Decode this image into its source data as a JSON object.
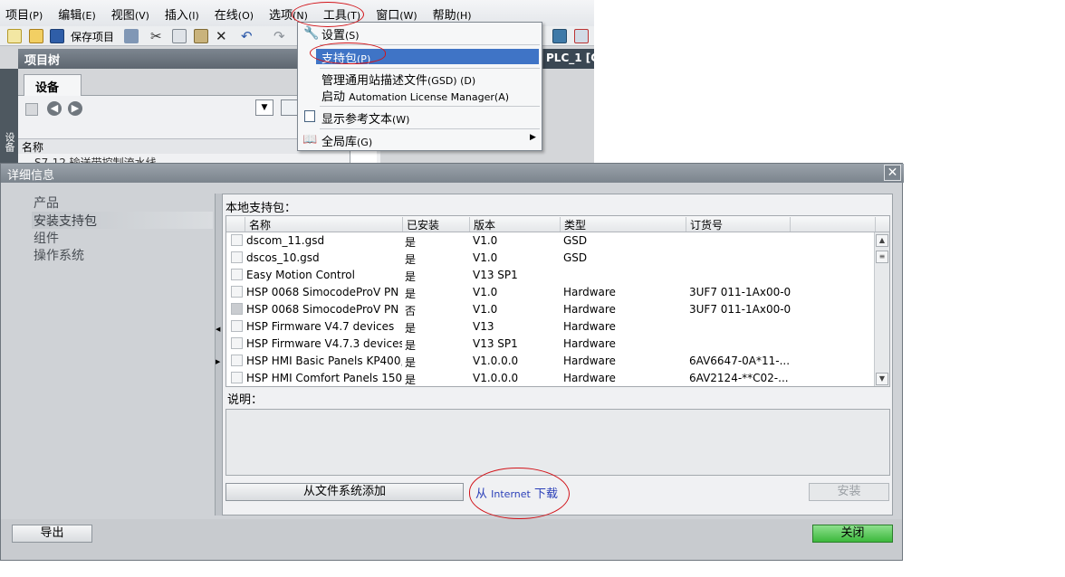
{
  "menubar": {
    "items": [
      {
        "label": "项目",
        "key": "(P)"
      },
      {
        "label": "编辑",
        "key": "(E)"
      },
      {
        "label": "视图",
        "key": "(V)"
      },
      {
        "label": "插入",
        "key": "(I)"
      },
      {
        "label": "在线",
        "key": "(O)"
      },
      {
        "label": "选项",
        "key": "(N)"
      },
      {
        "label": "工具",
        "key": "(T)"
      },
      {
        "label": "窗口",
        "key": "(W)"
      },
      {
        "label": "帮助",
        "key": "(H)"
      }
    ]
  },
  "toolbar": {
    "save_label": "保存项目"
  },
  "project_tree": {
    "title": "项目树",
    "side_label": "设备",
    "tab": "设备",
    "column_name": "名称",
    "row_partial": "S7-12 输送带控制流水线"
  },
  "editor": {
    "plc_title": "PLC_1 [C"
  },
  "options_menu": {
    "items": [
      {
        "label": "设置",
        "key": "(S)"
      },
      {
        "label": "支持包",
        "key": "(P)"
      },
      {
        "label": "管理通用站描述文件",
        "key": "(GSD) (D)"
      },
      {
        "label": "启动",
        "key": "Automation License Manager(A)"
      },
      {
        "label": "显示参考文本",
        "key": "(W)"
      },
      {
        "label": "全局库",
        "key": "(G)"
      }
    ]
  },
  "dialog": {
    "title": "详细信息",
    "nav": [
      "产品",
      "安装支持包",
      "组件",
      "操作系统"
    ],
    "local_packages_label": "本地支持包：",
    "columns": [
      "名称",
      "已安装",
      "版本",
      "类型",
      "订货号"
    ],
    "rows": [
      {
        "name": "dscom_11.gsd",
        "installed": "是",
        "version": "V1.0",
        "type": "GSD",
        "order": ""
      },
      {
        "name": "dscos_10.gsd",
        "installed": "是",
        "version": "V1.0",
        "type": "GSD",
        "order": ""
      },
      {
        "name": "Easy Motion Control",
        "installed": "是",
        "version": "V13 SP1",
        "type": "",
        "order": ""
      },
      {
        "name": "HSP 0068 SimocodeProV PN",
        "installed": "是",
        "version": "V1.0",
        "type": "Hardware",
        "order": "3UF7 011-1Ax00-0"
      },
      {
        "name": "HSP 0068 SimocodeProV PN",
        "installed": "否",
        "version": "V1.0",
        "type": "Hardware",
        "order": "3UF7 011-1Ax00-0"
      },
      {
        "name": "HSP Firmware V4.7 devices",
        "installed": "是",
        "version": "V13",
        "type": "Hardware",
        "order": ""
      },
      {
        "name": "HSP Firmware V4.7.3 devices ..",
        "installed": "是",
        "version": "V13 SP1",
        "type": "Hardware",
        "order": ""
      },
      {
        "name": "HSP HMI Basic Panels KP400, ..",
        "installed": "是",
        "version": "V1.0.0.0",
        "type": "Hardware",
        "order": "6AV6647-0A*11-..."
      },
      {
        "name": "HSP HMI Comfort Panels 1500..",
        "installed": "是",
        "version": "V1.0.0.0",
        "type": "Hardware",
        "order": "6AV2124-**C02-..."
      }
    ],
    "description_label": "说明：",
    "add_from_fs": "从文件系统添加",
    "download_internet": {
      "pre": "从",
      "mid": "Internet",
      "post": "下载"
    },
    "install": "安装",
    "export": "导出",
    "close": "关闭"
  },
  "colors": {
    "menu_highlight": "#3f74c6",
    "annotation_red": "#d2141a",
    "link": "#2a3fb8",
    "close_button": "#3cb83c"
  }
}
